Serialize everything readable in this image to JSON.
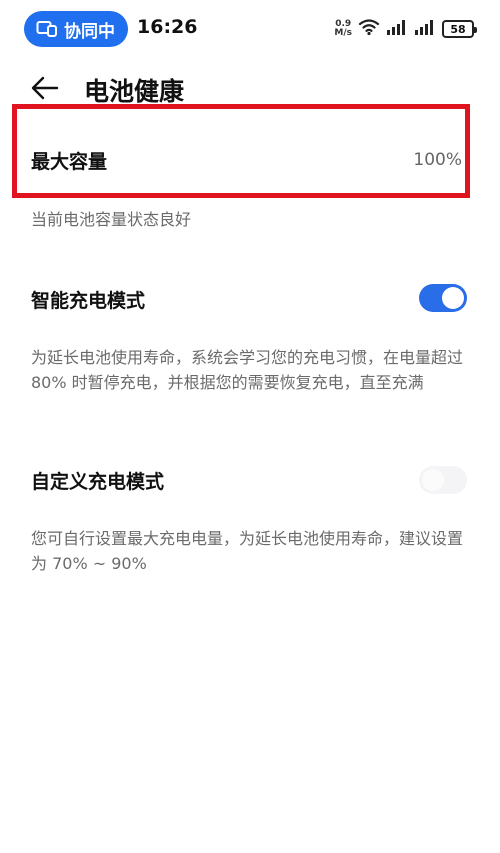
{
  "status_bar": {
    "collab_label": "协同中",
    "time": "16:26",
    "net_speed_value": "0.9",
    "net_speed_unit": "M/s",
    "battery": "58"
  },
  "header": {
    "title": "电池健康"
  },
  "max_capacity": {
    "label": "最大容量",
    "value": "100%",
    "status": "当前电池容量状态良好"
  },
  "smart_charging": {
    "label": "智能充电模式",
    "enabled": true,
    "description": "为延长电池使用寿命，系统会学习您的充电习惯，在电量超过 80% 时暂停充电，并根据您的需要恢复充电，直至充满"
  },
  "custom_charging": {
    "label": "自定义充电模式",
    "enabled": false,
    "description": "您可自行设置最大充电电量，为延长电池使用寿命，建议设置为 70% ~ 90%"
  },
  "colors": {
    "accent": "#2a6de8",
    "pill": "#1f6fee",
    "highlight": "#e0141e"
  }
}
